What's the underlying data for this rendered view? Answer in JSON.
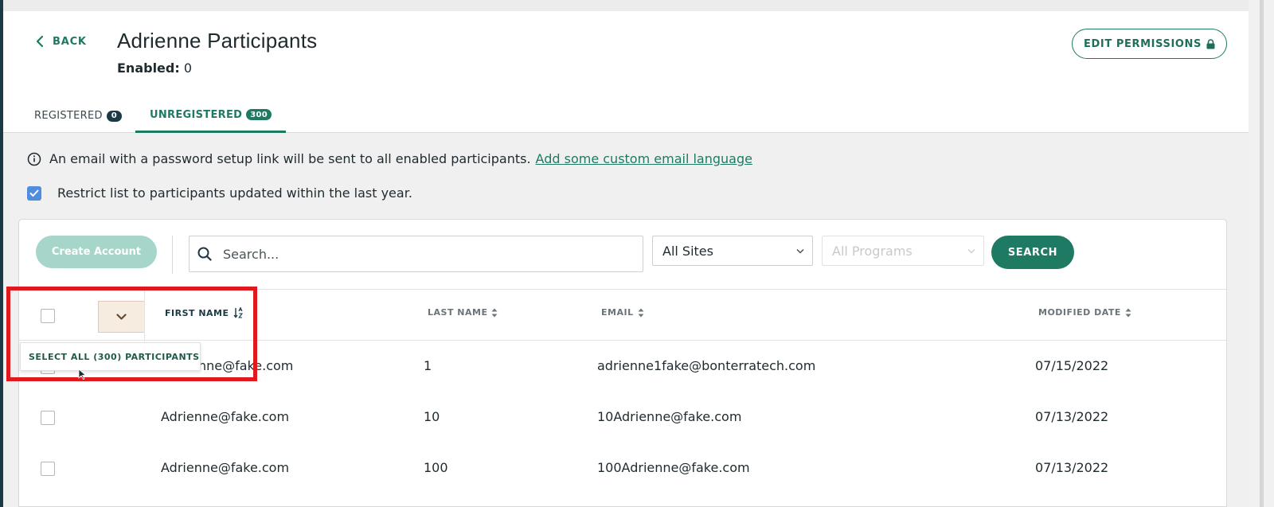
{
  "header": {
    "back_label": "BACK",
    "title": "Adrienne Participants",
    "enabled_label": "Enabled:",
    "enabled_value": "0",
    "edit_permissions_label": "EDIT PERMISSIONS"
  },
  "tabs": [
    {
      "label": "REGISTERED",
      "count": "0",
      "active": false
    },
    {
      "label": "UNREGISTERED",
      "count": "300",
      "active": true
    }
  ],
  "notice": {
    "text": "An email with a password setup link will be sent to all enabled participants.",
    "link": "Add some custom email language"
  },
  "restrict": {
    "checked": true,
    "label": "Restrict list to participants updated within the last year."
  },
  "toolbar": {
    "create_account_label": "Create Account",
    "search_placeholder": "Search...",
    "sites_selected": "All Sites",
    "programs_selected": "All Programs",
    "search_button_label": "SEARCH"
  },
  "table": {
    "columns": {
      "first_name": "FIRST NAME",
      "last_name": "LAST NAME",
      "email": "EMAIL",
      "modified_date": "MODIFIED DATE"
    },
    "select_all_label": "SELECT ALL (300) PARTICIPANTS",
    "rows": [
      {
        "first_name": "Adrienne@fake.com",
        "first_name_visible": "nne@fake.com",
        "last_name": "1",
        "email": "adrienne1fake@bonterratech.com",
        "modified_date": "07/15/2022"
      },
      {
        "first_name": "Adrienne@fake.com",
        "last_name": "10",
        "email": "10Adrienne@fake.com",
        "modified_date": "07/13/2022"
      },
      {
        "first_name": "Adrienne@fake.com",
        "last_name": "100",
        "email": "100Adrienne@fake.com",
        "modified_date": "07/13/2022"
      }
    ]
  },
  "colors": {
    "brand_green": "#1f7a63",
    "disabled_green": "#a6d5c9",
    "dark_navy": "#1b3a45",
    "highlight_red": "#e0191f",
    "checkbox_blue": "#4f8ede"
  }
}
